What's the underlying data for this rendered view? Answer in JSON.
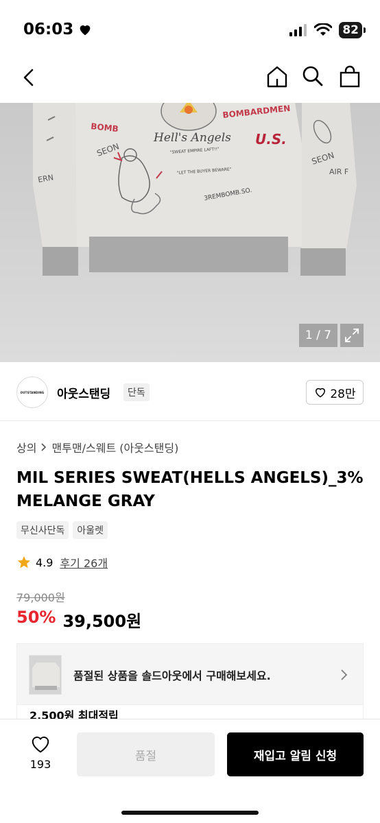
{
  "status": {
    "time": "06:03",
    "battery": "82"
  },
  "brand": {
    "logo_text": "OUTSTANDING",
    "name": "아웃스탠딩",
    "tag": "단독",
    "likes": "28만"
  },
  "gallery": {
    "counter": "1 / 7"
  },
  "breadcrumb": {
    "level1": "상의",
    "level2": "맨투맨/스웨트 (아웃스탠딩)"
  },
  "product": {
    "title": "MIL SERIES SWEAT(HELLS ANGELS)_3% MELANGE GRAY",
    "tags": [
      "무신사단독",
      "아울렛"
    ],
    "rating": "4.9",
    "reviews": "후기 26개",
    "original_price": "79,000원",
    "discount": "50%",
    "price": "39,500원"
  },
  "soldout_banner": {
    "text": "품절된 상품을 솔드아웃에서 구매해보세요."
  },
  "points": {
    "text": "2,500원 최대적립"
  },
  "bottom": {
    "wish_count": "193",
    "soldout_label": "품절",
    "restock_label": "재입고 알림 신청"
  },
  "hero_image_text": [
    "Hell's Angels",
    "BOMB",
    "BOMBARDMEN",
    "U.S.",
    "SEON",
    "AIR F",
    "ERN",
    "\"SWEAT EMPIRE LAFT!!\"",
    "\"LET THE BUYER BEWARE\"",
    "3REMBOMB.SO."
  ]
}
